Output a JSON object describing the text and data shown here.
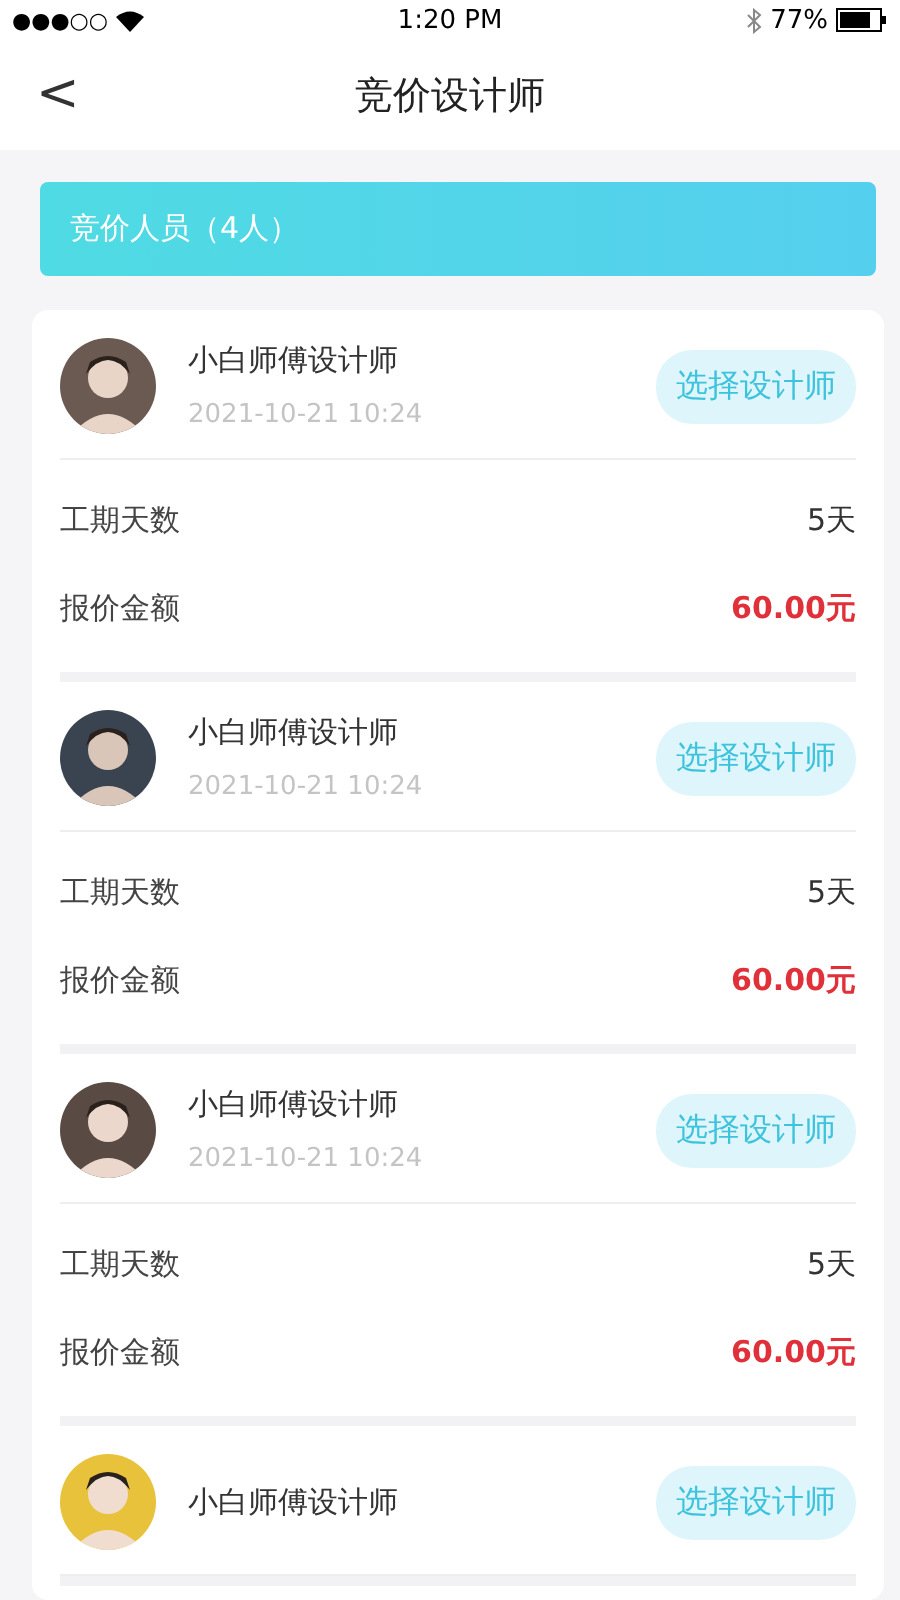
{
  "status_bar": {
    "signal": "●●●○○",
    "time": "1:20 PM",
    "battery": "77%"
  },
  "nav": {
    "back": "<",
    "title": "竞价设计师"
  },
  "banner": {
    "label": "竞价人员（4人）"
  },
  "bidders": [
    {
      "name": "小白师傅设计师",
      "time": "2021-10-21 10:24",
      "button": "选择设计师",
      "rows": [
        {
          "label": "工期天数",
          "value": "5天",
          "kind": "plain"
        },
        {
          "label": "报价金额",
          "value": "60.00元",
          "kind": "price"
        }
      ]
    },
    {
      "name": "小白师傅设计师",
      "time": "2021-10-21 10:24",
      "button": "选择设计师",
      "rows": [
        {
          "label": "工期天数",
          "value": "5天",
          "kind": "plain"
        },
        {
          "label": "报价金额",
          "value": "60.00元",
          "kind": "price"
        }
      ]
    },
    {
      "name": "小白师傅设计师",
      "time": "2021-10-21 10:24",
      "button": "选择设计师",
      "rows": [
        {
          "label": "工期天数",
          "value": "5天",
          "kind": "plain"
        },
        {
          "label": "报价金额",
          "value": "60.00元",
          "kind": "price"
        }
      ]
    },
    {
      "name": "小白师傅设计师",
      "button": "选择设计师"
    }
  ]
}
